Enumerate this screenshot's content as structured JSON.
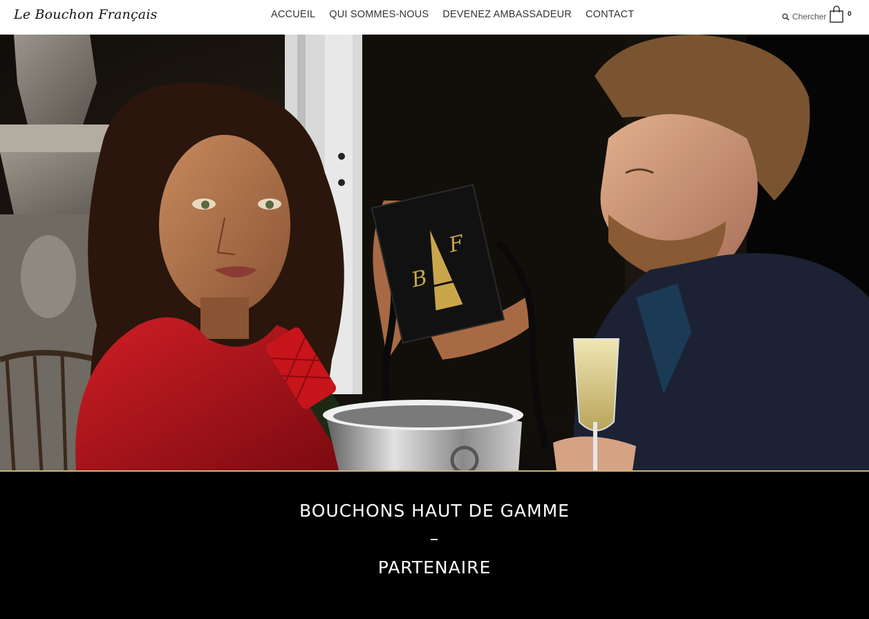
{
  "brand": {
    "logo_text": "Le Bouchon Français"
  },
  "nav": {
    "items": [
      {
        "label": "ACCUEIL"
      },
      {
        "label": "QUI SOMMES-NOUS"
      },
      {
        "label": "DEVENEZ AMBASSADEUR"
      },
      {
        "label": "CONTACT"
      }
    ]
  },
  "search": {
    "label": "Chercher",
    "icon": "search-icon"
  },
  "cart": {
    "icon": "shopping-bag-icon",
    "count": "0"
  },
  "hero": {
    "box_monogram_left": "B",
    "box_monogram_right": "F",
    "colors": {
      "box": "#111111",
      "gold": "#c9a64a",
      "dress": "#b3141c",
      "jacket": "#1c2233"
    }
  },
  "banner": {
    "line1": "BOUCHONS HAUT DE GAMME",
    "line2": "–",
    "line3": "PARTENAIRE"
  },
  "colors": {
    "accent_gold": "#c9b37a",
    "header_bg": "#ffffff",
    "banner_bg": "#000000"
  }
}
